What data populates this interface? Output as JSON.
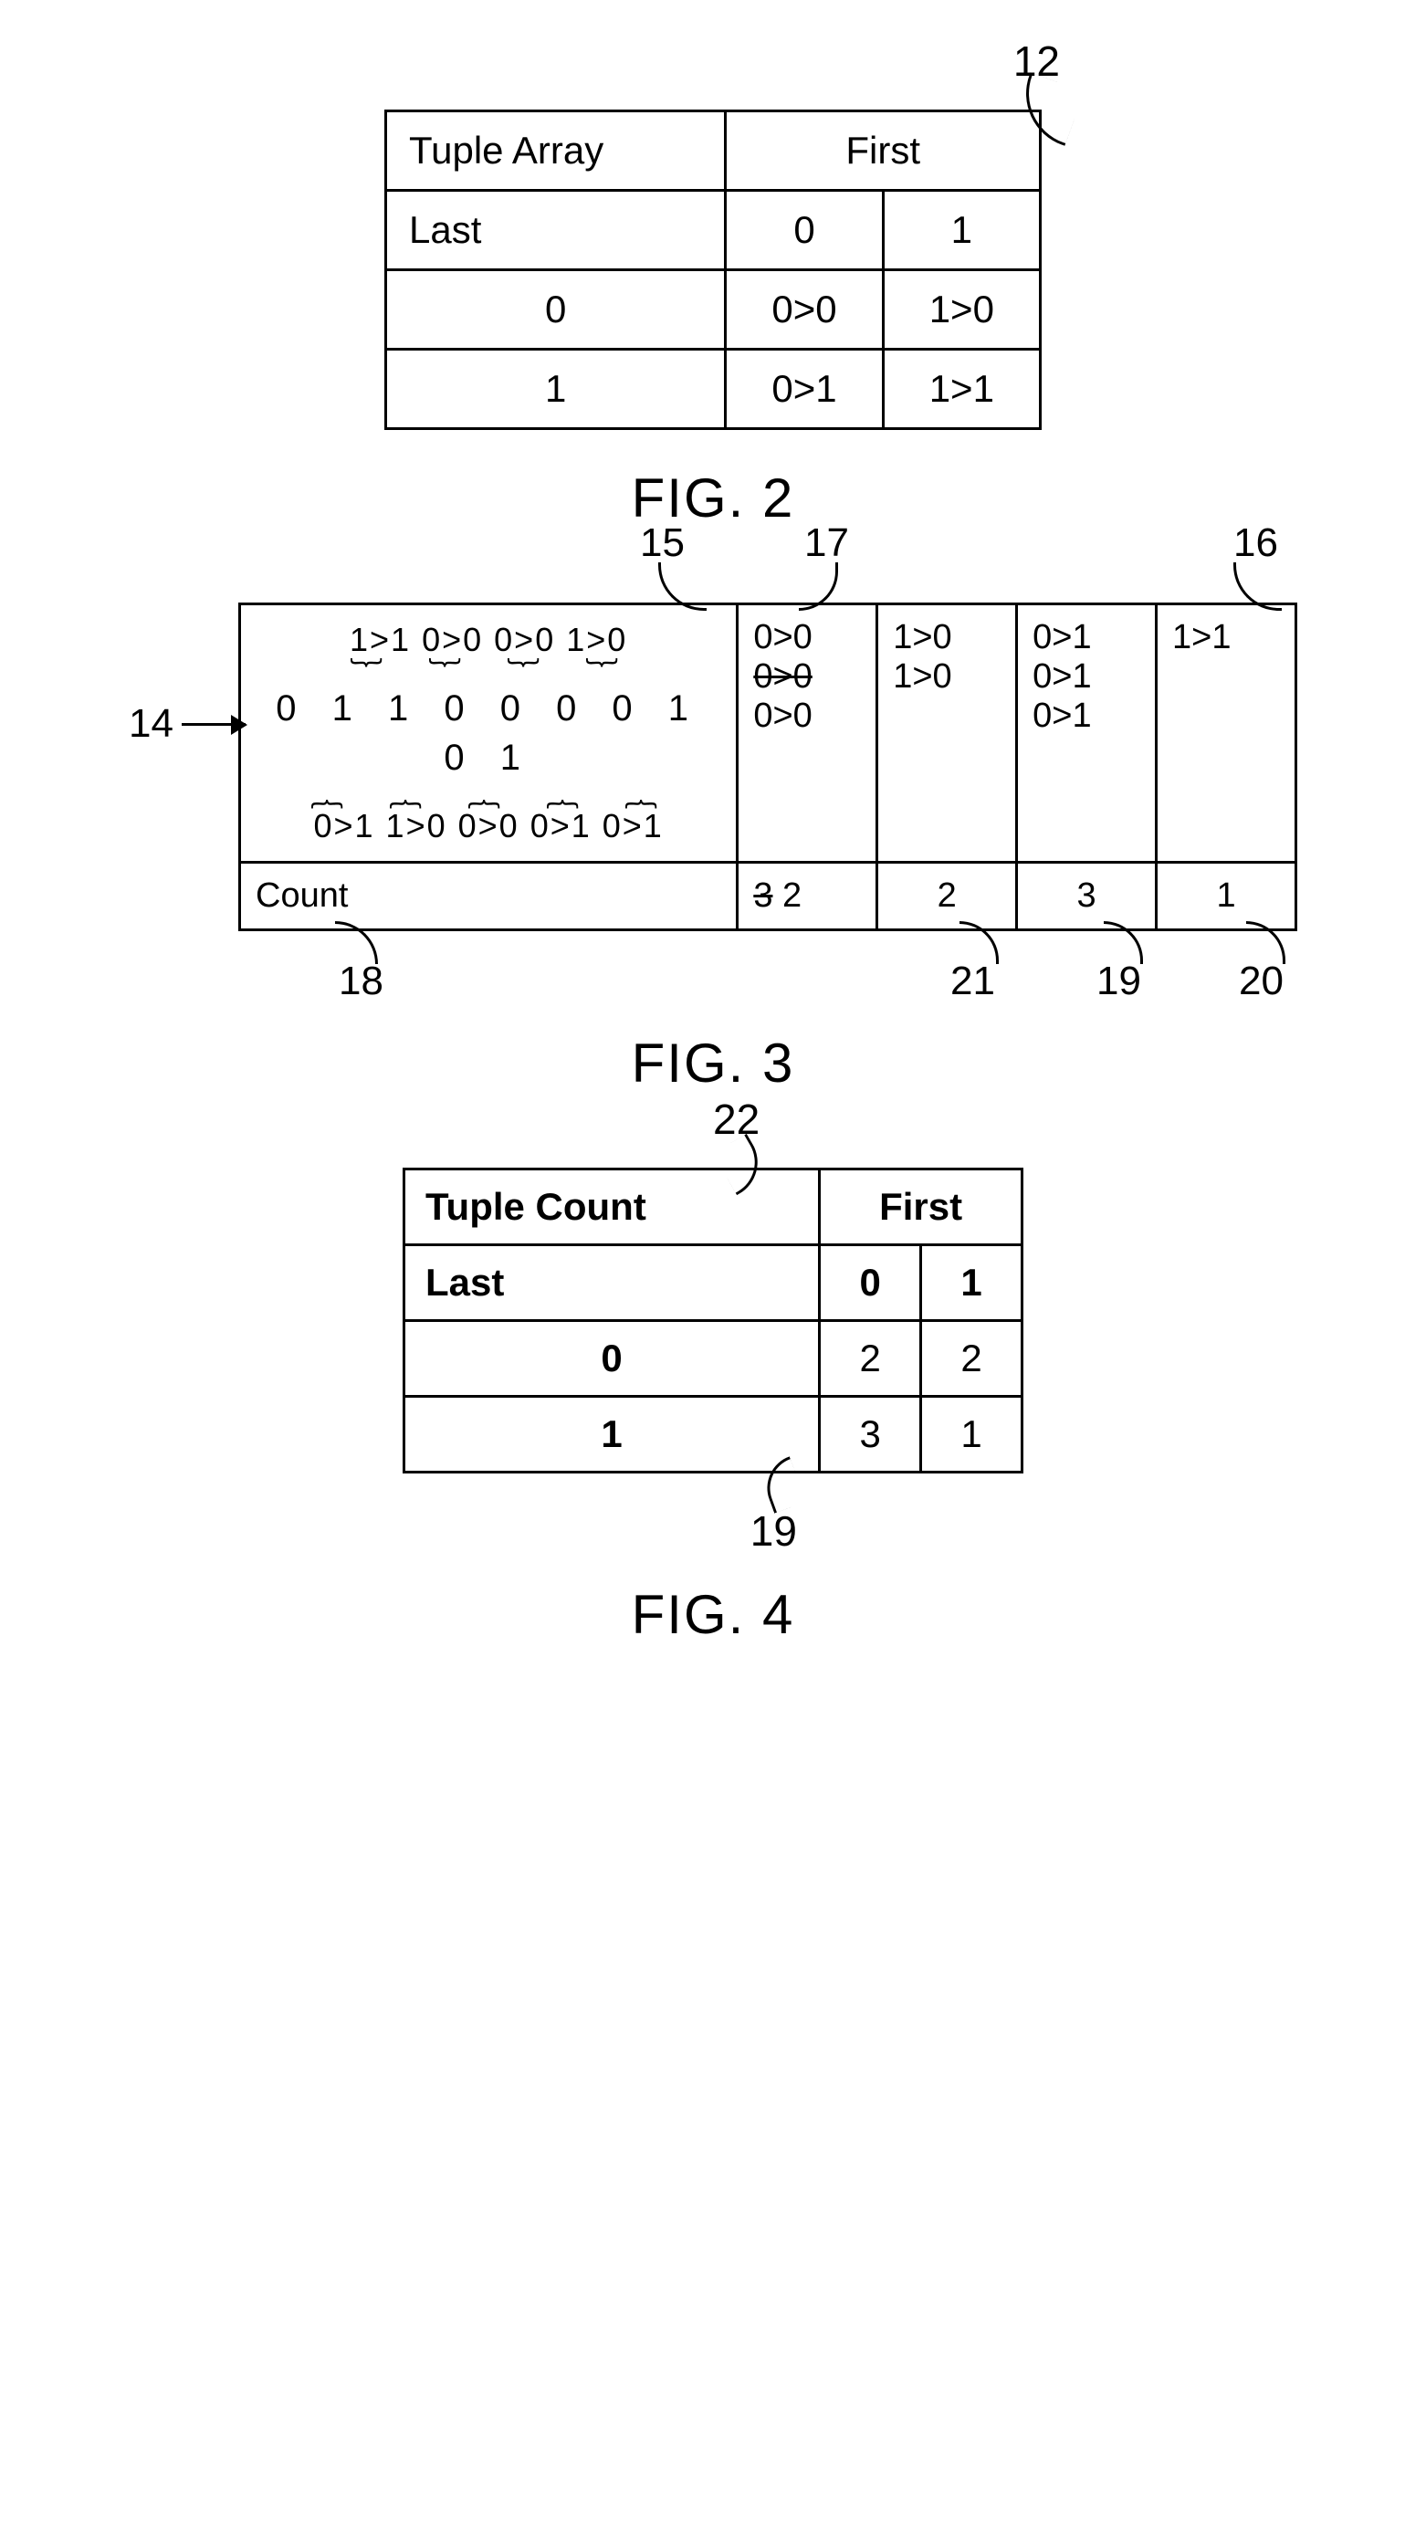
{
  "fig2": {
    "ref": "12",
    "caption": "FIG. 2",
    "title": "Tuple Array",
    "first": "First",
    "last": "Last",
    "colhdr": [
      "0",
      "1"
    ],
    "rows": [
      {
        "label": "0",
        "cells": [
          "0>0",
          "1>0"
        ]
      },
      {
        "label": "1",
        "cells": [
          "0>1",
          "1>1"
        ]
      }
    ]
  },
  "fig3": {
    "caption": "FIG. 3",
    "refs": {
      "r14": "14",
      "r15": "15",
      "r16": "16",
      "r17": "17",
      "r18": "18",
      "r19": "19",
      "r20": "20",
      "r21": "21"
    },
    "top_tuples": "1>1  0>0  0>0  1>0",
    "digits": "0 1 1 0 0 0 0 1 0 1",
    "bottom_tuples": "0>1 1>0 0>0 0>1 0>1",
    "columns": [
      {
        "hdr": "0>0",
        "items": [
          "0>0",
          "0>0"
        ],
        "struck_item": "0>0",
        "count": "2",
        "count_struck": "3"
      },
      {
        "hdr": "1>0",
        "items": [
          "1>0"
        ],
        "count": "2"
      },
      {
        "hdr": "0>1",
        "items": [
          "0>1",
          "0>1"
        ],
        "count": "3"
      },
      {
        "hdr": "1>1",
        "items": [],
        "count": "1"
      }
    ],
    "count_label": "Count"
  },
  "fig4": {
    "ref_top": "22",
    "ref_bot": "19",
    "caption": "FIG. 4",
    "title": "Tuple Count",
    "first": "First",
    "last": "Last",
    "colhdr": [
      "0",
      "1"
    ],
    "rows": [
      {
        "label": "0",
        "cells": [
          "2",
          "2"
        ]
      },
      {
        "label": "1",
        "cells": [
          "3",
          "1"
        ]
      }
    ]
  }
}
